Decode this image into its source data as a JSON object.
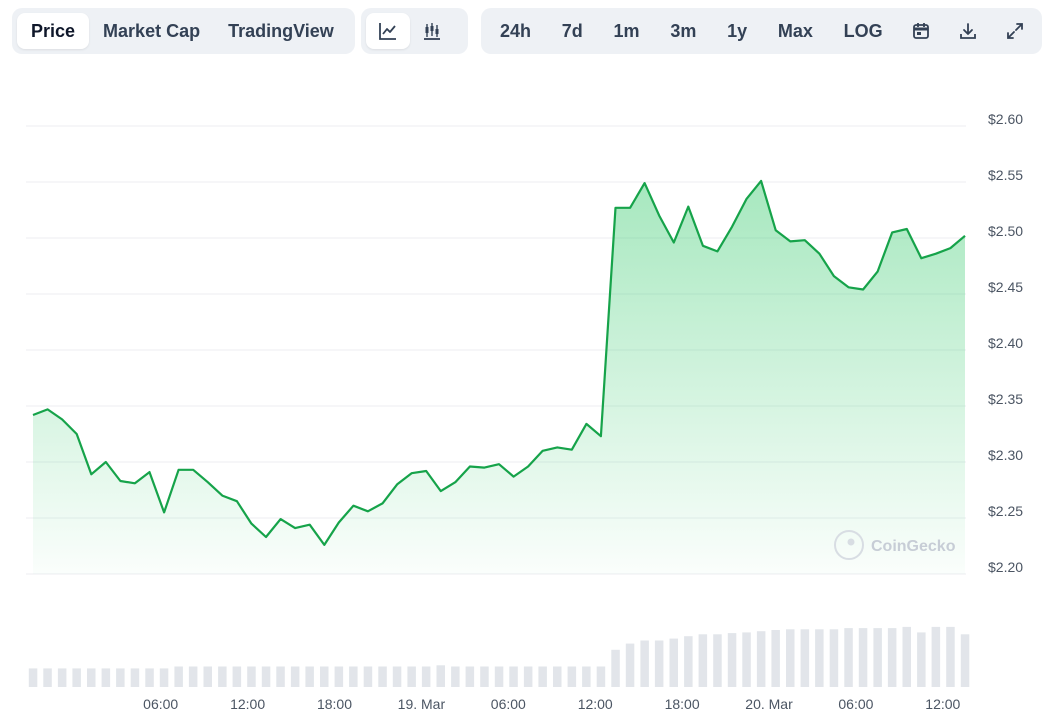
{
  "toolbar": {
    "metric_tabs": [
      {
        "label": "Price",
        "active": true
      },
      {
        "label": "Market Cap",
        "active": false
      },
      {
        "label": "TradingView",
        "active": false
      }
    ],
    "chart_style_icons": [
      "line-chart-icon",
      "candlestick-chart-icon"
    ],
    "ranges": [
      "24h",
      "7d",
      "1m",
      "3m",
      "1y",
      "Max"
    ],
    "log_label": "LOG",
    "tool_icons": [
      "calendar-icon",
      "download-icon",
      "expand-icon"
    ]
  },
  "watermark": "CoinGecko",
  "colors": {
    "line": "#16a34a",
    "fill": "#22c55e",
    "volume": "#e2e5ea",
    "grid": "#eceef2"
  },
  "chart_data": {
    "type": "area",
    "title": "",
    "xlabel": "",
    "ylabel": "",
    "ylim": [
      2.2,
      2.6
    ],
    "y_ticks": [
      2.2,
      2.25,
      2.3,
      2.35,
      2.4,
      2.45,
      2.5,
      2.55,
      2.6
    ],
    "y_tick_labels": [
      "$2.20",
      "$2.25",
      "$2.30",
      "$2.35",
      "$2.40",
      "$2.45",
      "$2.50",
      "$2.55",
      "$2.60"
    ],
    "x_range_hours": [
      -3.3,
      61.6
    ],
    "x_ticks": [
      {
        "label": "06:00",
        "hour": 6
      },
      {
        "label": "12:00",
        "hour": 12
      },
      {
        "label": "18:00",
        "hour": 18
      },
      {
        "label": "19. Mar",
        "hour": 24
      },
      {
        "label": "06:00",
        "hour": 30
      },
      {
        "label": "12:00",
        "hour": 36
      },
      {
        "label": "18:00",
        "hour": 42
      },
      {
        "label": "20. Mar",
        "hour": 48
      },
      {
        "label": "06:00",
        "hour": 54
      },
      {
        "label": "12:00",
        "hour": 60
      }
    ],
    "series": [
      {
        "values": [
          2.342,
          2.347,
          2.338,
          2.325,
          2.289,
          2.3,
          2.283,
          2.281,
          2.291,
          2.255,
          2.293,
          2.293,
          2.282,
          2.27,
          2.265,
          2.245,
          2.233,
          2.249,
          2.241,
          2.244,
          2.226,
          2.246,
          2.261,
          2.256,
          2.263,
          2.28,
          2.29,
          2.292,
          2.274,
          2.282,
          2.296,
          2.295,
          2.298,
          2.287,
          2.296,
          2.31,
          2.313,
          2.311,
          2.334,
          2.323,
          2.527,
          2.527,
          2.549,
          2.52,
          2.496,
          2.528,
          2.493,
          2.488,
          2.51,
          2.535,
          2.551,
          2.507,
          2.497,
          2.498,
          2.486,
          2.466,
          2.456,
          2.454,
          2.47,
          2.505,
          2.508,
          2.482,
          2.486,
          2.491,
          2.502
        ]
      }
    ],
    "volume_relative": [
      0.3,
      0.3,
      0.3,
      0.3,
      0.3,
      0.3,
      0.3,
      0.3,
      0.3,
      0.3,
      0.33,
      0.33,
      0.33,
      0.33,
      0.33,
      0.33,
      0.33,
      0.33,
      0.33,
      0.33,
      0.33,
      0.33,
      0.33,
      0.33,
      0.33,
      0.33,
      0.33,
      0.33,
      0.35,
      0.33,
      0.33,
      0.33,
      0.33,
      0.33,
      0.33,
      0.33,
      0.33,
      0.33,
      0.33,
      0.33,
      0.6,
      0.7,
      0.75,
      0.75,
      0.78,
      0.82,
      0.85,
      0.85,
      0.87,
      0.88,
      0.9,
      0.92,
      0.93,
      0.93,
      0.93,
      0.93,
      0.95,
      0.95,
      0.95,
      0.95,
      0.97,
      0.88,
      0.97,
      0.97,
      0.85
    ],
    "grid": true,
    "legend": "none"
  }
}
